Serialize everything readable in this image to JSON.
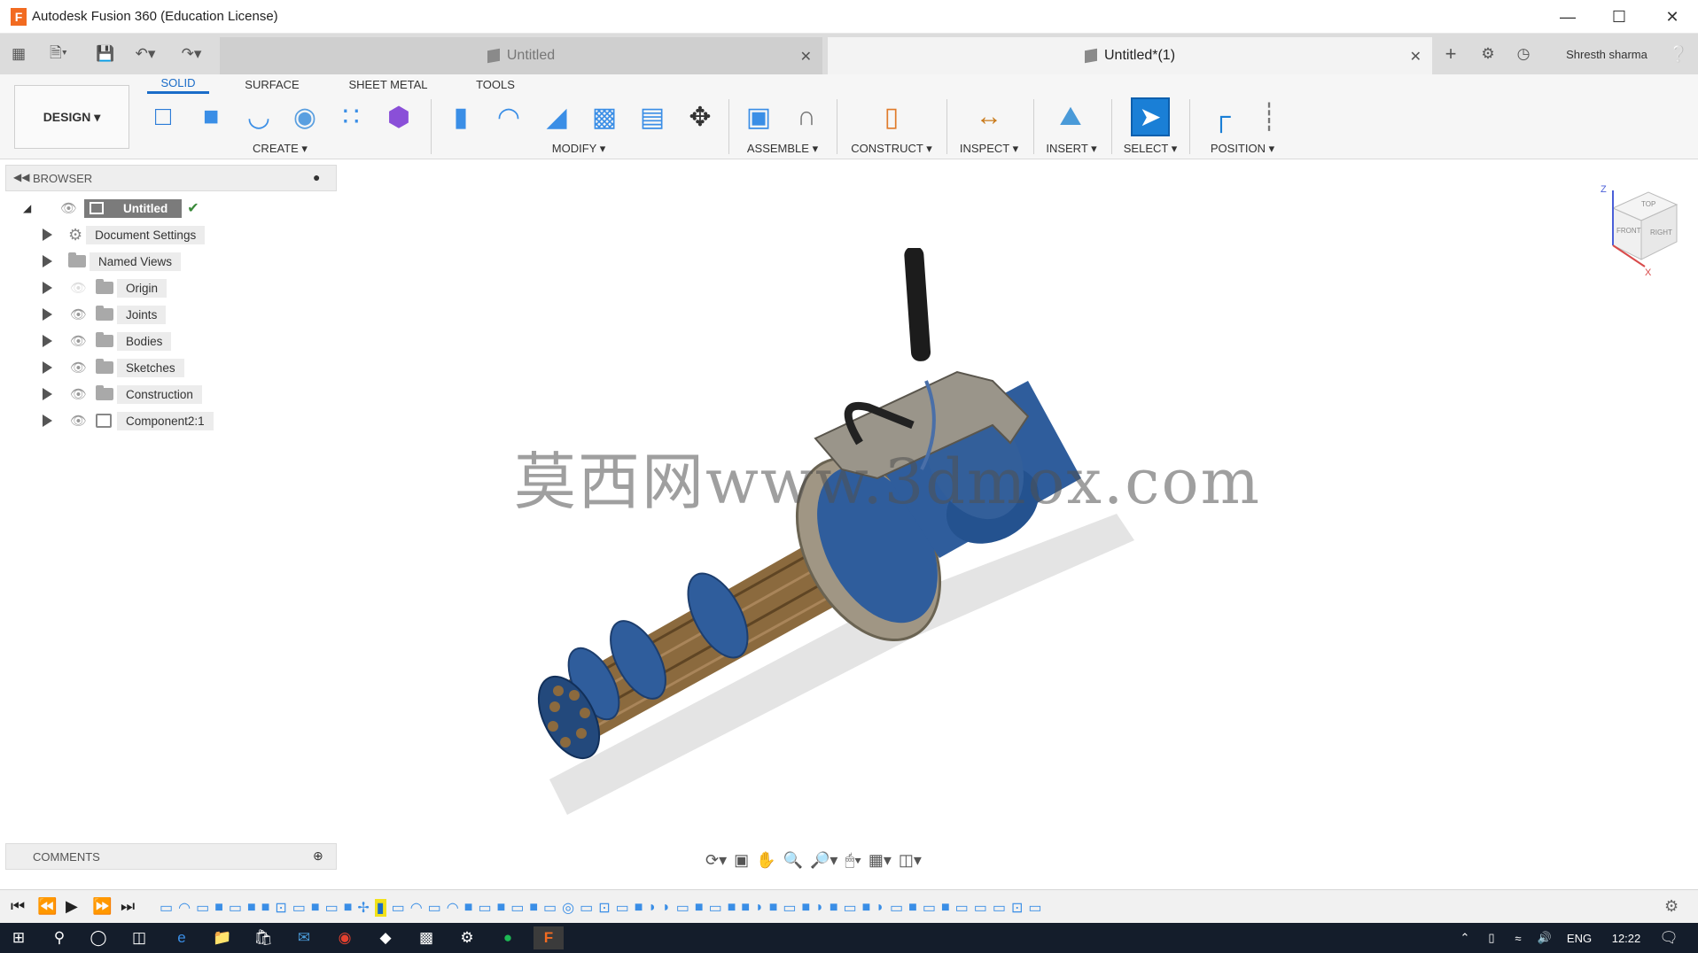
{
  "app": {
    "window_title": "Autodesk Fusion 360 (Education License)",
    "logo_letter": "F"
  },
  "tabs": [
    {
      "label": "Untitled",
      "active": false
    },
    {
      "label": "Untitled*(1)",
      "active": true
    }
  ],
  "user": {
    "name": "Shresth sharma"
  },
  "ribbon": {
    "tabs": [
      "SOLID",
      "SURFACE",
      "SHEET METAL",
      "TOOLS"
    ],
    "design_label": "DESIGN",
    "groups": {
      "create": "CREATE",
      "modify": "MODIFY",
      "assemble": "ASSEMBLE",
      "construct": "CONSTRUCT",
      "inspect": "INSPECT",
      "insert": "INSERT",
      "select": "SELECT",
      "position": "POSITION"
    }
  },
  "browser": {
    "title": "BROWSER",
    "root": "Untitled",
    "items": [
      {
        "label": "Document Settings",
        "icon": "gear-icon"
      },
      {
        "label": "Named Views",
        "icon": "folder-icon"
      },
      {
        "label": "Origin",
        "icon": "folder-icon",
        "hidden": true
      },
      {
        "label": "Joints",
        "icon": "folder-icon"
      },
      {
        "label": "Bodies",
        "icon": "folder-icon"
      },
      {
        "label": "Sketches",
        "icon": "folder-icon"
      },
      {
        "label": "Construction",
        "icon": "folder-icon"
      },
      {
        "label": "Component2:1",
        "icon": "component-icon"
      }
    ]
  },
  "comments": {
    "title": "COMMENTS"
  },
  "viewcube": {
    "top": "TOP",
    "front": "FRONT",
    "right": "RIGHT",
    "axis_z": "Z",
    "axis_x": "X"
  },
  "watermark": "莫西网www.3dmox.com",
  "taskbar": {
    "lang": "ENG",
    "time": "12:22"
  },
  "colors": {
    "accent": "#1a6cc8",
    "model_blue": "#2f5d9c",
    "model_brass": "#8b6a3e",
    "frame_grey": "#8a8a8a",
    "taskbar": "#141d2b"
  }
}
